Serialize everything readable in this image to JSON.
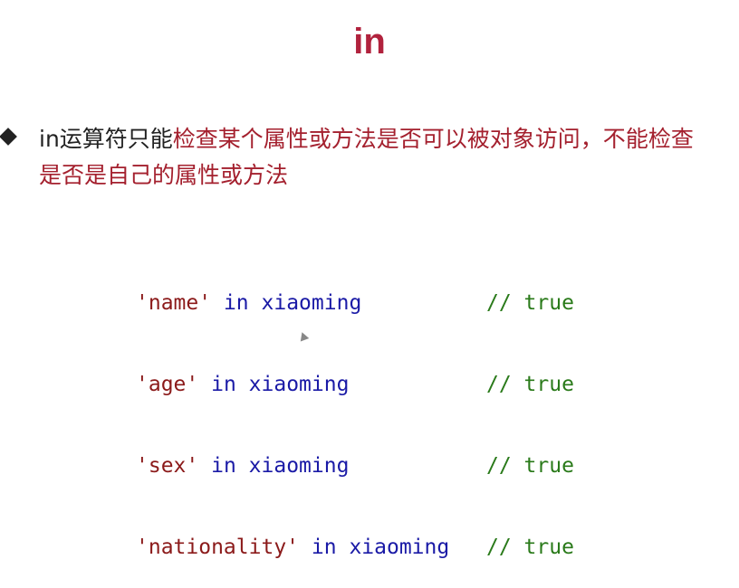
{
  "slide": {
    "title": "in"
  },
  "bullet": {
    "prefix": "in运算符只能",
    "highlight_1": "检查某个属性或方法是否可以被对象访问，不",
    "highlight_2": "能检查是否是自己的属性或方法"
  },
  "code": {
    "lines": [
      {
        "string": "'name'",
        "keyword": "in",
        "identifier": "xiaoming",
        "comment": "// true"
      },
      {
        "string": "'age'",
        "keyword": "in",
        "identifier": "xiaoming",
        "comment": "// true"
      },
      {
        "string": "'sex'",
        "keyword": "in",
        "identifier": "xiaoming",
        "comment": "// true"
      },
      {
        "string": "'nationality'",
        "keyword": "in",
        "identifier": "xiaoming",
        "comment": "// true"
      }
    ]
  },
  "colors": {
    "title": "#b1223d",
    "highlight_text": "#a4202e",
    "code_string": "#8b1a1a",
    "code_keyword": "#1a1aa6",
    "code_comment": "#2a7a1a"
  },
  "icons": {
    "bullet": "diamond-bullet-icon",
    "cursor": "mouse-pointer-icon"
  }
}
